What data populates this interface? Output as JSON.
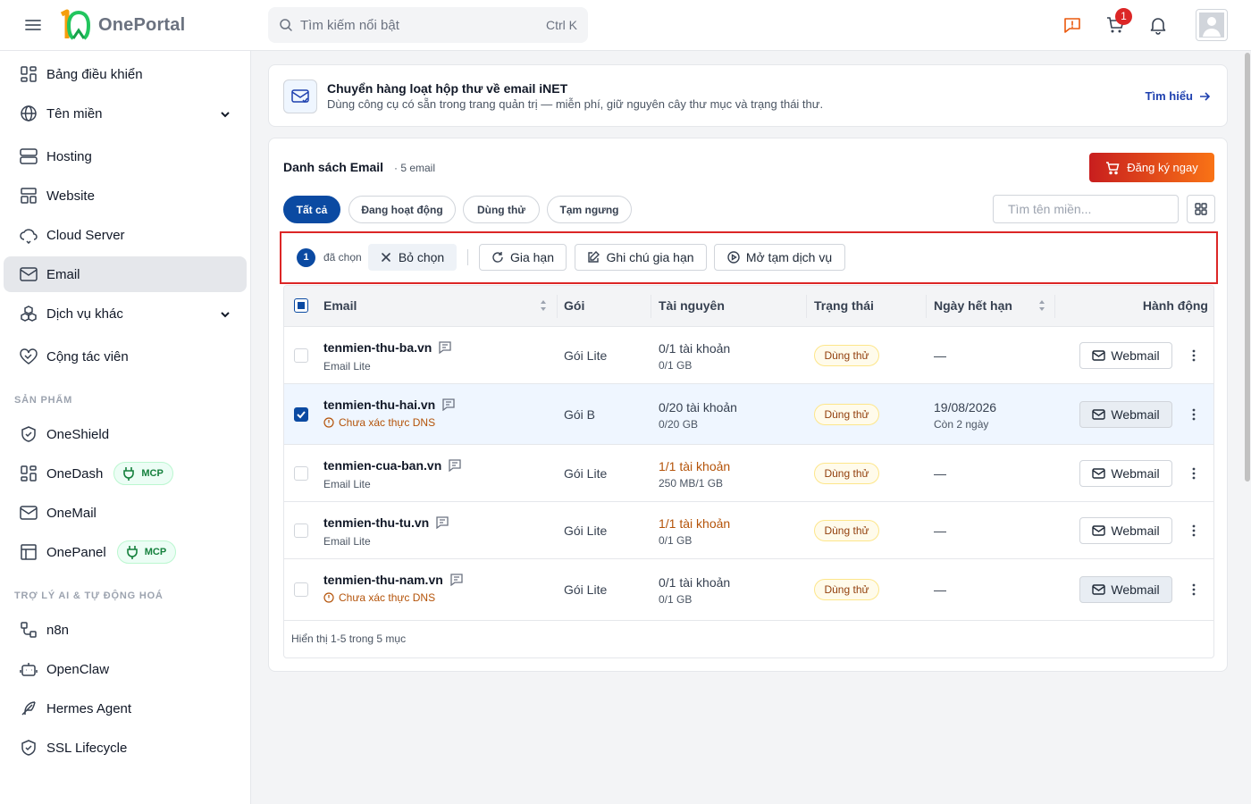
{
  "app": {
    "name": "OnePortal",
    "logo_mark": "10"
  },
  "search": {
    "placeholder": "Tìm kiếm nổi bật",
    "shortcut": "Ctrl K"
  },
  "header": {
    "cart_count": "1"
  },
  "sidebar": {
    "items": [
      {
        "label": "Bảng điều khiển",
        "icon": "dashboard-icon"
      },
      {
        "label": "Tên miền",
        "icon": "globe-icon",
        "expandable": true
      },
      {
        "label": "Hosting",
        "icon": "server-icon"
      },
      {
        "label": "Website",
        "icon": "layout-icon"
      },
      {
        "label": "Cloud Server",
        "icon": "cloud-icon"
      },
      {
        "label": "Email",
        "icon": "mail-icon",
        "active": true
      },
      {
        "label": "Dịch vụ khác",
        "icon": "boxes-icon",
        "expandable": true
      },
      {
        "label": "Cộng tác viên",
        "icon": "handshake-icon"
      }
    ],
    "section_products": "SẢN PHẨM",
    "products": [
      {
        "label": "OneShield",
        "icon": "shield-icon"
      },
      {
        "label": "OneDash",
        "icon": "dashboard-icon",
        "badge": "MCP"
      },
      {
        "label": "OneMail",
        "icon": "mail-icon"
      },
      {
        "label": "OnePanel",
        "icon": "panel-icon",
        "badge": "MCP"
      }
    ],
    "section_ai": "TRỢ LÝ AI & TỰ ĐỘNG HOÁ",
    "ai": [
      {
        "label": "n8n",
        "icon": "workflow-icon"
      },
      {
        "label": "OpenClaw",
        "icon": "bot-icon"
      },
      {
        "label": "Hermes Agent",
        "icon": "feather-icon"
      },
      {
        "label": "SSL Lifecycle",
        "icon": "shield-check-icon"
      }
    ]
  },
  "banner": {
    "title": "Chuyển hàng loạt hộp thư về email iNET",
    "description": "Dùng công cụ có sẵn trong trang quản trị — miễn phí, giữ nguyên cây thư mục và trạng thái thư.",
    "link": "Tìm hiểu"
  },
  "list": {
    "title": "Danh sách Email",
    "count": "· 5 email",
    "register_label": "Đăng ký ngay",
    "filters": [
      "Tất cả",
      "Đang hoạt động",
      "Dùng thử",
      "Tạm ngưng"
    ],
    "active_filter": "Tất cả",
    "search_placeholder": "Tìm tên miền..."
  },
  "bulk": {
    "selected_count": "1",
    "selected_text": "đã chọn",
    "clear_label": "Bỏ chọn",
    "actions": [
      "Gia hạn",
      "Ghi chú gia hạn",
      "Mở tạm dịch vụ"
    ]
  },
  "table": {
    "columns": [
      "Email",
      "Gói",
      "Tài nguyên",
      "Trạng thái",
      "Ngày hết hạn",
      "Hành động"
    ],
    "rows": [
      {
        "domain": "tenmien-thu-ba.vn",
        "sub": "Email Lite",
        "warning": false,
        "plan": "Gói Lite",
        "accounts": "0/1 tài khoản",
        "storage": "0/1 GB",
        "accounts_full": false,
        "status": "Dùng thử",
        "expiry": "—",
        "expiry_note": "",
        "checked": false,
        "webmail": "Webmail",
        "webmail_muted": false
      },
      {
        "domain": "tenmien-thu-hai.vn",
        "sub": "Chưa xác thực DNS",
        "warning": true,
        "plan": "Gói B",
        "accounts": "0/20 tài khoản",
        "storage": "0/20 GB",
        "accounts_full": false,
        "status": "Dùng thử",
        "expiry": "19/08/2026",
        "expiry_note": "Còn 2 ngày",
        "checked": true,
        "webmail": "Webmail",
        "webmail_muted": true
      },
      {
        "domain": "tenmien-cua-ban.vn",
        "sub": "Email Lite",
        "warning": false,
        "plan": "Gói Lite",
        "accounts": "1/1 tài khoản",
        "storage": "250 MB/1 GB",
        "accounts_full": true,
        "status": "Dùng thử",
        "expiry": "—",
        "expiry_note": "",
        "checked": false,
        "webmail": "Webmail",
        "webmail_muted": false
      },
      {
        "domain": "tenmien-thu-tu.vn",
        "sub": "Email Lite",
        "warning": false,
        "plan": "Gói Lite",
        "accounts": "1/1 tài khoản",
        "storage": "0/1 GB",
        "accounts_full": true,
        "status": "Dùng thử",
        "expiry": "—",
        "expiry_note": "",
        "checked": false,
        "webmail": "Webmail",
        "webmail_muted": false
      },
      {
        "domain": "tenmien-thu-nam.vn",
        "sub": "Chưa xác thực DNS",
        "warning": true,
        "plan": "Gói Lite",
        "accounts": "0/1 tài khoản",
        "storage": "0/1 GB",
        "accounts_full": false,
        "status": "Dùng thử",
        "expiry": "—",
        "expiry_note": "",
        "checked": false,
        "webmail": "Webmail",
        "webmail_muted": true
      }
    ],
    "footer": "Hiển thị 1-5 trong 5 mục"
  },
  "colors": {
    "primary": "#0b4aa2",
    "danger": "#dc2626",
    "warning": "#b45309",
    "accent_gradient_start": "#c81e1e",
    "accent_gradient_end": "#f97316"
  }
}
